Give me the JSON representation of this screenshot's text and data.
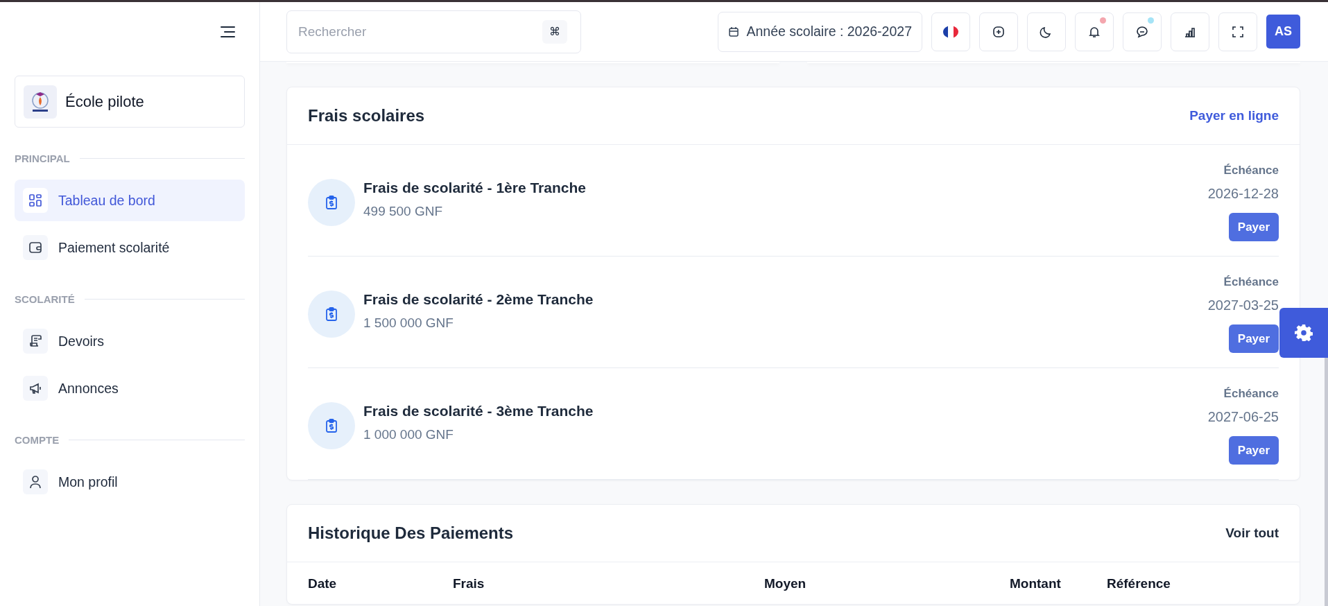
{
  "sidebar": {
    "brand": {
      "name": "École pilote"
    },
    "sections": [
      {
        "title": "PRINCIPAL",
        "items": [
          {
            "label": "Tableau de bord",
            "kind": "dashboard",
            "selected": true
          },
          {
            "label": "Paiement scolarité",
            "kind": "wallet",
            "selected": false
          }
        ]
      },
      {
        "title": "SCOLARITÉ",
        "items": [
          {
            "label": "Devoirs",
            "kind": "scroll",
            "selected": false
          },
          {
            "label": "Annonces",
            "kind": "megaphone",
            "selected": false
          }
        ]
      },
      {
        "title": "COMPTE",
        "items": [
          {
            "label": "Mon profil",
            "kind": "user",
            "selected": false
          }
        ]
      }
    ]
  },
  "topbar": {
    "search": {
      "placeholder": "Rechercher",
      "shortcut": "⌘"
    },
    "school_year": "Année scolaire : 2026-2027",
    "buttons": [
      {
        "kind": "flag"
      },
      {
        "kind": "plus"
      },
      {
        "kind": "moon"
      },
      {
        "kind": "bell",
        "color": "#f4a6ae"
      },
      {
        "kind": "chat",
        "color": "#a5e3f6"
      },
      {
        "kind": "chart"
      },
      {
        "kind": "fullscreen"
      }
    ],
    "avatar": "AS"
  },
  "fees": {
    "title": "Frais scolaires",
    "action": "Payer en ligne",
    "items": [
      {
        "name": "Frais de scolarité - 1ère Tranche",
        "amount": "499 500 GNF",
        "due_label": "Échéance",
        "due_date": "2026-12-28",
        "button": "Payer"
      },
      {
        "name": "Frais de scolarité - 2ème Tranche",
        "amount": "1 500 000 GNF",
        "due_label": "Échéance",
        "due_date": "2027-03-25",
        "button": "Payer"
      },
      {
        "name": "Frais de scolarité - 3ème Tranche",
        "amount": "1 000 000 GNF",
        "due_label": "Échéance",
        "due_date": "2027-06-25",
        "button": "Payer"
      }
    ]
  },
  "history": {
    "title": "Historique Des Paiements",
    "action": "Voir tout",
    "columns": [
      "Date",
      "Frais",
      "Moyen",
      "Montant",
      "Référence"
    ]
  }
}
